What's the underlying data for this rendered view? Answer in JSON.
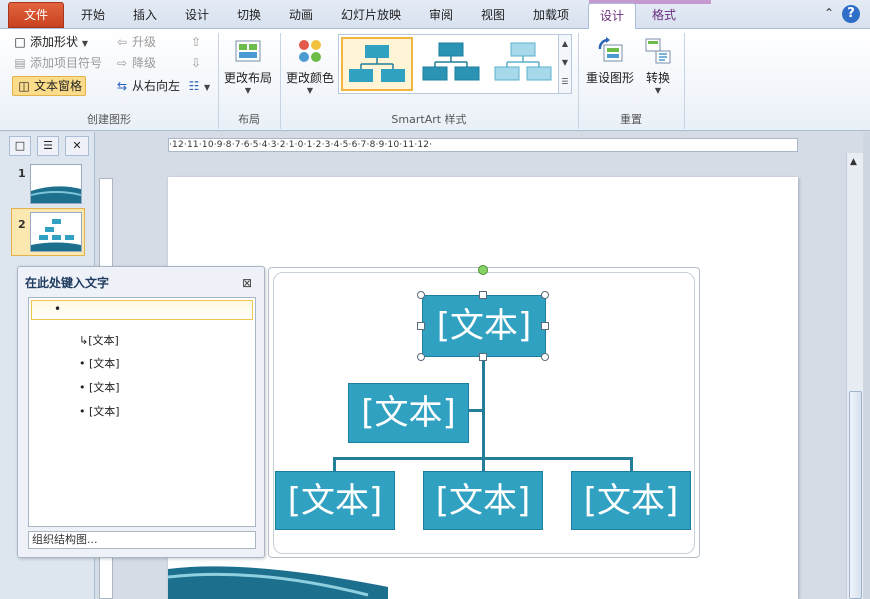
{
  "tabs": {
    "file": "文件",
    "items": [
      "开始",
      "插入",
      "设计",
      "切换",
      "动画",
      "幻灯片放映",
      "审阅",
      "视图",
      "加载项"
    ],
    "context": [
      "设计",
      "格式"
    ],
    "active": "设计"
  },
  "groups": {
    "create": {
      "label": "创建图形",
      "add_shape": "添加形状",
      "add_bullet": "添加项目符号",
      "text_pane": "文本窗格",
      "promote": "升级",
      "demote": "降级",
      "right_to_left": "从右向左"
    },
    "layout": {
      "label": "布局",
      "change_layout": "更改布局"
    },
    "styles": {
      "label": "SmartArt 样式",
      "change_colors": "更改颜色"
    },
    "reset": {
      "label": "重置",
      "reset_graphic": "重设图形",
      "convert": "转换"
    }
  },
  "slides": {
    "numbers": [
      "1",
      "2"
    ]
  },
  "ruler": {
    "marks": "·12·11·10·9·8·7·6·5·4·3·2·1·0·1·2·3·4·5·6·7·8·9·10·11·12·"
  },
  "text_pane": {
    "title": "在此处键入文字",
    "items": [
      "[文本]",
      "[文本]",
      "[文本]",
      "[文本]"
    ],
    "footer": "组织结构图..."
  },
  "smartart": {
    "box_text": "[文本]"
  },
  "colors": {
    "box_fill": "#31a1c1",
    "connector": "#237e99",
    "file_tab": "#c9421f"
  }
}
